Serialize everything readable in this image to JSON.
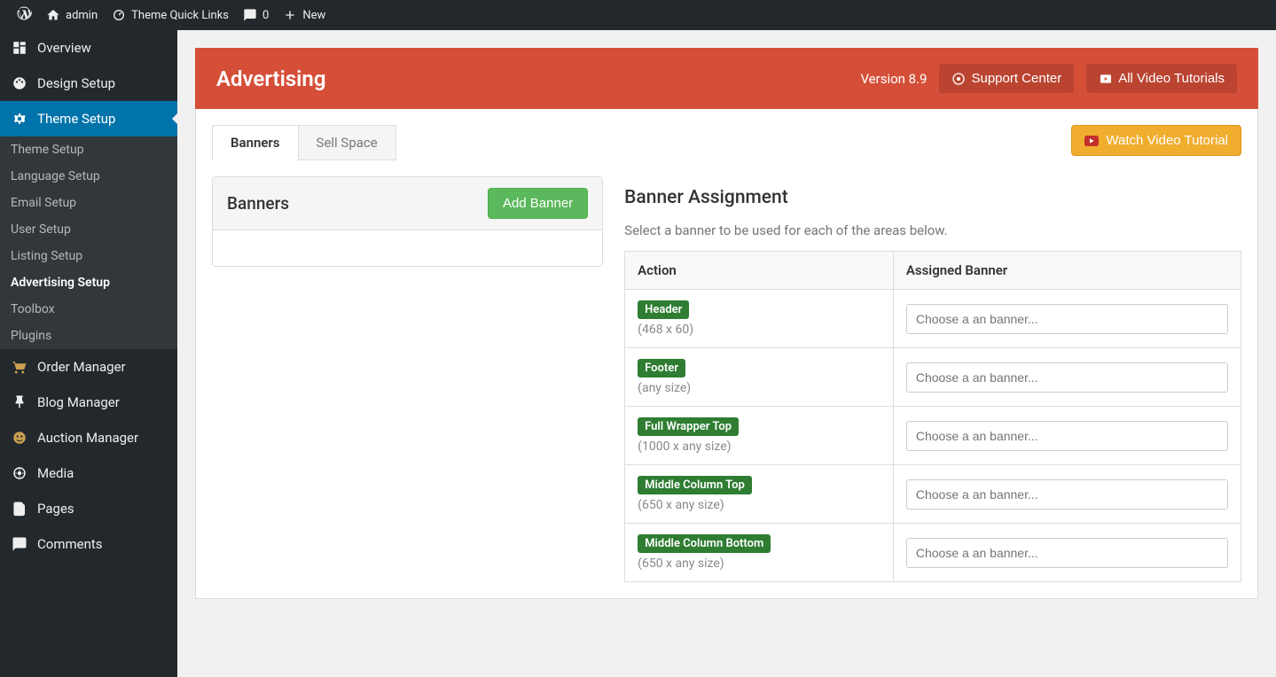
{
  "adminbar": {
    "site": "admin",
    "themeLinks": "Theme Quick Links",
    "commentsCount": "0",
    "new": "New"
  },
  "sidebar": {
    "items": [
      {
        "label": "Overview",
        "icon": "dashboard"
      },
      {
        "label": "Design Setup",
        "icon": "palette"
      },
      {
        "label": "Theme Setup",
        "icon": "gear",
        "active": true,
        "subitems": [
          {
            "label": "Theme Setup"
          },
          {
            "label": "Language Setup"
          },
          {
            "label": "Email Setup"
          },
          {
            "label": "User Setup"
          },
          {
            "label": "Listing Setup"
          },
          {
            "label": "Advertising Setup",
            "active": true
          },
          {
            "label": "Toolbox"
          },
          {
            "label": "Plugins"
          }
        ]
      },
      {
        "label": "Order Manager",
        "icon": "cart"
      },
      {
        "label": "Blog Manager",
        "icon": "pin"
      },
      {
        "label": "Auction Manager",
        "icon": "face"
      },
      {
        "label": "Media",
        "icon": "media"
      },
      {
        "label": "Pages",
        "icon": "pages"
      },
      {
        "label": "Comments",
        "icon": "comment"
      }
    ]
  },
  "header": {
    "title": "Advertising",
    "version": "Version 8.9",
    "supportBtn": "Support Center",
    "tutorialsBtn": "All Video Tutorials"
  },
  "tabs": [
    {
      "label": "Banners",
      "active": true
    },
    {
      "label": "Sell Space"
    }
  ],
  "watchBtn": "Watch Video Tutorial",
  "bannersBox": {
    "title": "Banners",
    "addBtn": "Add Banner"
  },
  "assignment": {
    "title": "Banner Assignment",
    "desc": "Select a banner to be used for each of the areas below.",
    "colAction": "Action",
    "colAssigned": "Assigned Banner",
    "placeholder": "Choose a an banner...",
    "rows": [
      {
        "name": "Header",
        "size": "(468 x 60)"
      },
      {
        "name": "Footer",
        "size": "(any size)"
      },
      {
        "name": "Full Wrapper Top",
        "size": "(1000 x any size)"
      },
      {
        "name": "Middle Column Top",
        "size": "(650 x any size)"
      },
      {
        "name": "Middle Column Bottom",
        "size": "(650 x any size)"
      }
    ]
  }
}
